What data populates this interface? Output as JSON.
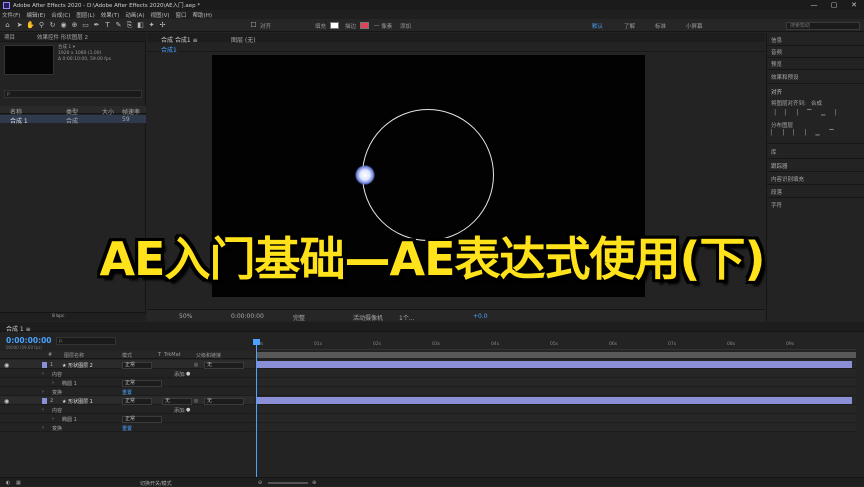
{
  "window": {
    "title": "Adobe After Effects 2020 - D:\\Adobe After Effects 2020\\AE入门.aep *",
    "controls": [
      "—",
      "▢",
      "✕"
    ]
  },
  "menu": [
    "文件(F)",
    "编辑(E)",
    "合成(C)",
    "图层(L)",
    "效果(T)",
    "动画(A)",
    "视图(V)",
    "窗口",
    "帮助(H)"
  ],
  "toolbar": {
    "align_label": "对齐",
    "fill_label": "填充",
    "stroke_label": "描边",
    "stroke_width": "一 像素",
    "add_label": "添加",
    "workspaces": [
      "默认",
      "了解",
      "标准",
      "小屏幕"
    ],
    "search_placeholder": "搜索帮助",
    "fill_color": "#ffffff",
    "stroke_color": "#e0425a"
  },
  "project": {
    "tabs": [
      "项目",
      "效果控件 形状图层 2"
    ],
    "item_name": "合成 1 ▾",
    "item_size": "1920 x 1080 (1.00)",
    "item_duration": "Δ 0:00:10:00, 59.00 fps",
    "search_placeholder": "ρ",
    "columns": [
      "名称",
      "类型",
      "大小",
      "帧速率"
    ],
    "rows": [
      {
        "name": "合成 1",
        "type": "合成",
        "size": "",
        "fps": "59"
      }
    ],
    "footer_label": "8 bpc"
  },
  "viewer": {
    "tabs": [
      "合成 合成1 ≡",
      "图层 (无)"
    ],
    "subtab": "合成1",
    "bottom": {
      "zoom": "50%",
      "time": "0:00:00:00",
      "quality": "完整",
      "camera": "活动摄像机",
      "views": "1个...",
      "exposure": "+0.0"
    }
  },
  "right_panel": {
    "items": [
      "信息",
      "音频",
      "预览",
      "效果和预设",
      "对齐",
      "将图层对齐到:",
      "合成",
      "分布图层",
      "库",
      "跟踪器",
      "内容识别填充",
      "段落",
      "字符"
    ]
  },
  "timeline": {
    "tab": "合成 1 ≡",
    "timecode": "0:00:00:00",
    "fps_readout": "00000 (59.00 fps)",
    "search_placeholder": "ρ.",
    "columns": [
      "#",
      "图层名称",
      "模式",
      "T",
      "TrkMat",
      "父级和链接"
    ],
    "layers": [
      {
        "num": "1",
        "name": "★ 形状图层 2",
        "mode": "正常",
        "trkmat": "",
        "parent": "无",
        "contents": "内容",
        "add": "添加:",
        "ellipse": "椭圆 1",
        "ellipse_mode": "正常",
        "transform": "变换",
        "reset": "重置"
      },
      {
        "num": "2",
        "name": "★ 形状图层 1",
        "mode": "正常",
        "trkmat": "无",
        "parent": "无",
        "contents": "内容",
        "add": "添加:",
        "ellipse": "椭圆 1",
        "ellipse_mode": "正常",
        "transform": "变换",
        "reset": "重置"
      }
    ],
    "ruler": [
      "0s",
      "01s",
      "02s",
      "03s",
      "04s",
      "05s",
      "06s",
      "07s",
      "08s",
      "09s"
    ],
    "footer_label": "切换开关/模式"
  },
  "overlay_title": "AE入门基础—AE表达式使用(下)"
}
